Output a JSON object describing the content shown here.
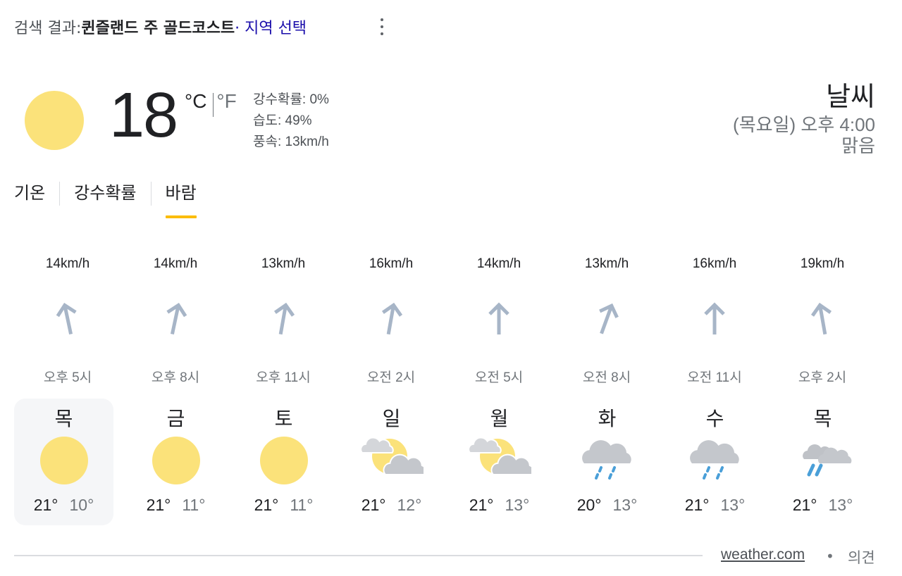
{
  "header": {
    "prefix": "검색 결과: ",
    "location": "퀸즐랜드 주 골드코스트",
    "region_link": " · 지역 선택"
  },
  "current": {
    "temperature": "18",
    "unit_c": "°C",
    "unit_f": "°F",
    "precipitation": "강수확률: 0%",
    "humidity": "습도: 49%",
    "wind": "풍속: 13km/h",
    "icon": "sun-icon"
  },
  "summary": {
    "title": "날씨",
    "time": "(목요일) 오후 4:00",
    "condition": "맑음"
  },
  "tabs": [
    {
      "label": "기온",
      "active": false
    },
    {
      "label": "강수확률",
      "active": false
    },
    {
      "label": "바람",
      "active": true
    }
  ],
  "wind_forecast": [
    {
      "speed": "14km/h",
      "time": "오후 5시",
      "direction_deg": -12
    },
    {
      "speed": "14km/h",
      "time": "오후 8시",
      "direction_deg": 12
    },
    {
      "speed": "13km/h",
      "time": "오후 11시",
      "direction_deg": 10
    },
    {
      "speed": "16km/h",
      "time": "오전 2시",
      "direction_deg": 10
    },
    {
      "speed": "14km/h",
      "time": "오전 5시",
      "direction_deg": 0
    },
    {
      "speed": "13km/h",
      "time": "오전 8시",
      "direction_deg": 20
    },
    {
      "speed": "16km/h",
      "time": "오전 11시",
      "direction_deg": 0
    },
    {
      "speed": "19km/h",
      "time": "오후 2시",
      "direction_deg": -10
    }
  ],
  "days": [
    {
      "name": "목",
      "high": "21°",
      "low": "10°",
      "icon": "sun-icon",
      "selected": true
    },
    {
      "name": "금",
      "high": "21°",
      "low": "11°",
      "icon": "sun-icon",
      "selected": false
    },
    {
      "name": "토",
      "high": "21°",
      "low": "11°",
      "icon": "sun-icon",
      "selected": false
    },
    {
      "name": "일",
      "high": "21°",
      "low": "12°",
      "icon": "partly-cloudy-icon",
      "selected": false
    },
    {
      "name": "월",
      "high": "21°",
      "low": "13°",
      "icon": "partly-cloudy-icon",
      "selected": false
    },
    {
      "name": "화",
      "high": "20°",
      "low": "13°",
      "icon": "rain-icon",
      "selected": false
    },
    {
      "name": "수",
      "high": "21°",
      "low": "13°",
      "icon": "rain-icon",
      "selected": false
    },
    {
      "name": "목",
      "high": "21°",
      "low": "13°",
      "icon": "scattered-showers-icon",
      "selected": false
    }
  ],
  "footer": {
    "source": "weather.com",
    "separator": "•",
    "feedback": "의견"
  },
  "colors": {
    "sun": "#fbe27a",
    "cloud": "#c4c7cc",
    "rain": "#4a9fd8",
    "wind_arrow": "#a7b5c7",
    "tab_indicator": "#fbbc04",
    "link": "#1a0dab"
  }
}
